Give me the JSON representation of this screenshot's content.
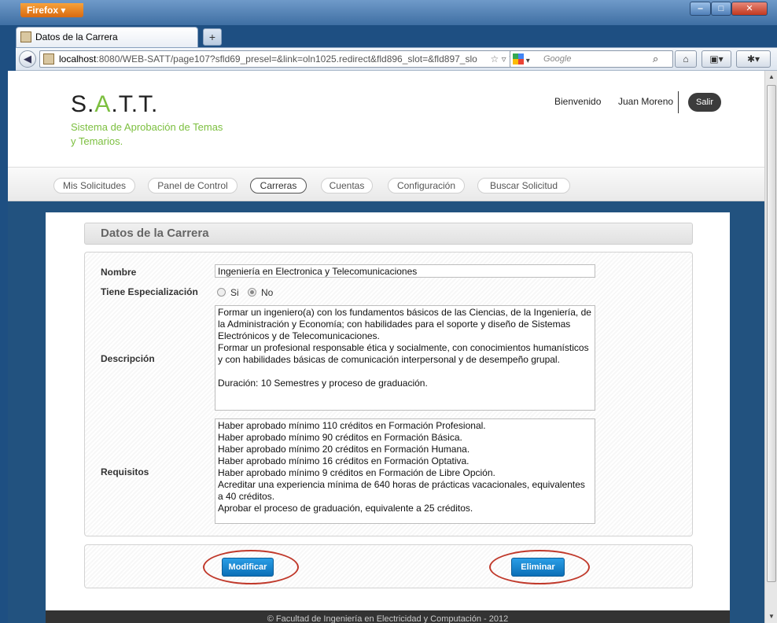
{
  "browser": {
    "app_button": "Firefox",
    "tab_title": "Datos de la Carrera",
    "new_tab": "+",
    "url_host": "localhost",
    "url_rest": ":8080/WEB-SATT/page107?sfld69_presel=&link=oln1025.redirect&fld896_slot=&fld897_slo",
    "search_placeholder": "Google"
  },
  "site": {
    "logo_prefix": "S.",
    "logo_accent": "A",
    "logo_suffix": ".T.T.",
    "slogan": "Sistema de Aprobación de Temas y Temarios.",
    "welcome": "Bienvenido",
    "username": "Juan Moreno",
    "logout": "Salir",
    "accent_color": "#7cbf3f"
  },
  "menu": {
    "items": [
      "Mis Solicitudes",
      "Panel de Control",
      "Carreras",
      "Cuentas",
      "Configuración",
      "Buscar Solicitud"
    ],
    "active": "Carreras"
  },
  "form": {
    "section_title": "Datos de la Carrera",
    "nombre_label": "Nombre",
    "nombre_value": "Ingeniería en Electronica y Telecomunicaciones",
    "especializacion_label": "Tiene Especialización",
    "option_si": "Si",
    "option_no": "No",
    "selected_option": "No",
    "descripcion_label": "Descripción",
    "descripcion_value": "Formar un ingeniero(a) con los fundamentos básicos de las Ciencias, de la Ingeniería, de la Administración y Economía; con habilidades para el soporte y diseño de Sistemas Electrónicos y de Telecomunicaciones.\nFormar un profesional responsable ética y socialmente, con conocimientos humanísticos y con habilidades básicas de comunicación interpersonal y de desempeño grupal.\n\nDuración: 10 Semestres y proceso de graduación.",
    "requisitos_label": "Requisitos",
    "requisitos_value": "Haber aprobado mínimo 110 créditos en Formación Profesional.\nHaber aprobado mínimo 90 créditos en Formación Básica.\nHaber aprobado mínimo 20 créditos en Formación Humana.\nHaber aprobado mínimo 16 créditos en Formación Optativa.\nHaber aprobado mínimo 9 créditos en Formación de Libre Opción.\nAcreditar una experiencia mínima de 640 horas de prácticas vacacionales, equivalentes a 40 créditos.\nAprobar el proceso de graduación, equivalente a 25 créditos."
  },
  "actions": {
    "modify_label": "Modificar",
    "delete_label": "Eliminar",
    "button_color": "#1a87d0",
    "highlight_color": "#c0392b"
  },
  "footer": {
    "text": "© Facultad de Ingeniería en Electricidad y Computación - 2012"
  }
}
